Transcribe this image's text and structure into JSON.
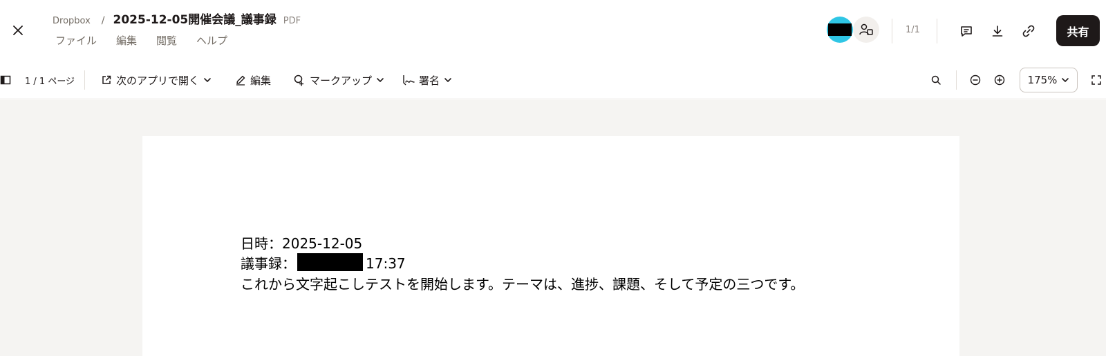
{
  "header": {
    "breadcrumb_root": "Dropbox",
    "breadcrumb_sep": "/",
    "title": "2025-12-05開催会議_議事録",
    "file_type": "PDF",
    "menu": [
      "ファイル",
      "編集",
      "閲覧",
      "ヘルプ"
    ],
    "page_count": "1/1",
    "share_label": "共有"
  },
  "toolbar": {
    "page_indicator": "1 / 1 ページ",
    "open_with": "次のアプリで開く",
    "edit": "編集",
    "markup": "マークアップ",
    "sign": "署名",
    "zoom": "175%"
  },
  "document": {
    "line1": "日時：2025-12-05",
    "line2_prefix": "議事録：",
    "line2_suffix": "17:37",
    "line3": "これから文字起こしテストを開始します。テーマは、進捗、課題、そして予定の三つです。"
  },
  "colors": {
    "accent_avatar": "#2fc6e5",
    "share_button": "#1e1919",
    "viewer_background": "#f5f4f2"
  },
  "icons": [
    "close-icon",
    "person-add-icon",
    "comment-icon",
    "download-icon",
    "link-icon",
    "sidebar-toggle-icon",
    "external-link-icon",
    "pencil-icon",
    "markup-icon",
    "signature-icon",
    "search-icon",
    "zoom-out-icon",
    "zoom-in-icon",
    "fullscreen-icon",
    "chevron-down-icon"
  ]
}
